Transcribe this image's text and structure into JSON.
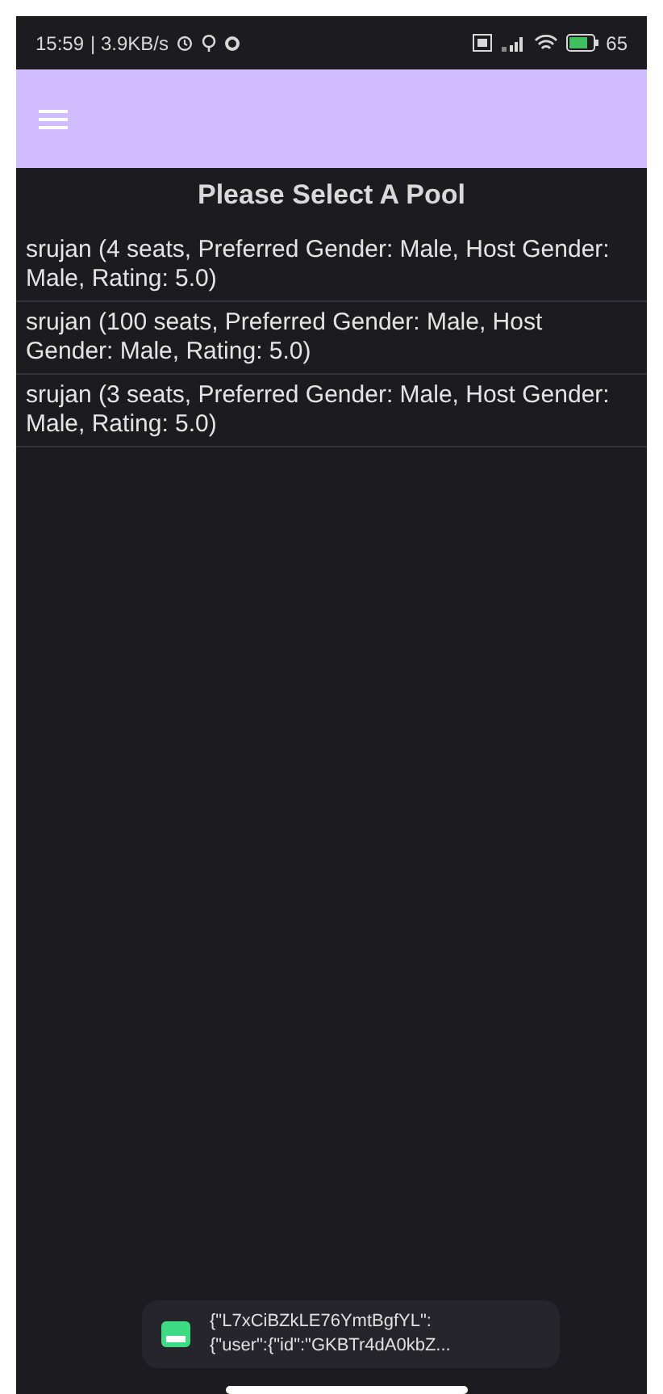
{
  "status_bar": {
    "time": "15:59",
    "speed": "| 3.9KB/s",
    "battery": "65"
  },
  "title": "Please Select A Pool",
  "pools": [
    {
      "text": "srujan (4 seats, Preferred Gender: Male, Host Gender: Male, Rating: 5.0)"
    },
    {
      "text": "srujan (100 seats, Preferred Gender: Male, Host Gender: Male, Rating: 5.0)"
    },
    {
      "text": "srujan (3 seats, Preferred Gender: Male, Host Gender: Male, Rating: 5.0)"
    }
  ],
  "toast": {
    "lines": [
      "{\"L7xCiBZkLE76YmtBgfYL\":",
      "{\"user\":{\"id\":\"GKBTr4dA0kbZ..."
    ]
  }
}
